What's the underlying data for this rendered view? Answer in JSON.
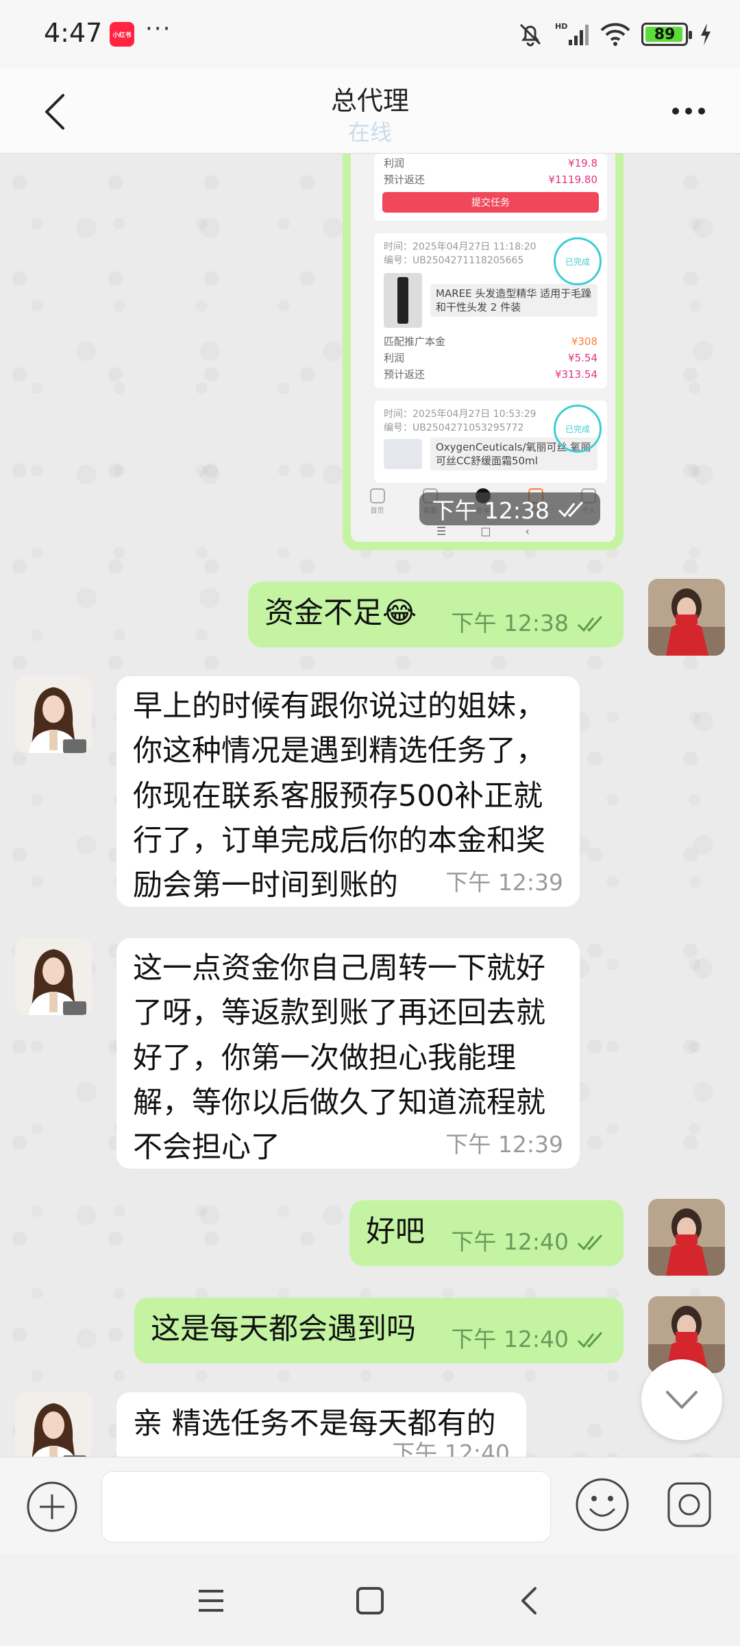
{
  "status_bar": {
    "time": "4:47",
    "app_badge": "小红书",
    "more": "···",
    "battery": "89"
  },
  "header": {
    "title": "总代理",
    "subtitle": "在线"
  },
  "shared_image": {
    "card1": {
      "profit_label": "利润",
      "profit_value": "¥19.8",
      "refund_label": "预计返还",
      "refund_value": "¥1119.80",
      "submit_label": "提交任务"
    },
    "card2": {
      "date": "时间：2025年04月27日 11:18:20",
      "order_no": "编号：UB2504271118205665",
      "product": "MAREE 头发造型精华 适用于毛躁和干性头发 2 件装",
      "principal_label": "匹配推广本金",
      "principal_value": "¥308",
      "profit_label": "利润",
      "profit_value": "¥5.54",
      "refund_label": "预计返还",
      "refund_value": "¥313.54",
      "stamp": "已完成"
    },
    "card3": {
      "date": "时间：2025年04月27日 10:53:29",
      "order_no": "编号：UB2504271053295772",
      "product": "OxygenCeuticals/氧丽可丝 氧丽可丝CC舒缓面霜50ml",
      "stamp": "已完成"
    },
    "tabs": [
      "首页",
      "客服",
      "抢单",
      "记录",
      "个人"
    ],
    "time": "下午 12:38"
  },
  "messages": [
    {
      "dir": "out",
      "text": "资金不足😂",
      "time": "下午 12:38"
    },
    {
      "dir": "in",
      "text": "早上的时候有跟你说过的姐妹，你这种情况是遇到精选任务了，你现在联系客服预存500补正就行了，订单完成后你的本金和奖励会第一时间到账的",
      "time": "下午 12:39"
    },
    {
      "dir": "in",
      "text": "这一点资金你自己周转一下就好了呀，等返款到账了再还回去就好了，你第一次做担心我能理解，等你以后做久了知道流程就不会担心了",
      "time": "下午 12:39"
    },
    {
      "dir": "out",
      "text": "好吧",
      "time": "下午 12:40"
    },
    {
      "dir": "out",
      "text": "这是每天都会遇到吗",
      "time": "下午 12:40"
    },
    {
      "dir": "in",
      "text": "亲 精选任务不是每天都有的",
      "time": "下午 12:40"
    }
  ],
  "input": {
    "placeholder": ""
  },
  "colors": {
    "outgoing_bubble": "#c4f4a2",
    "incoming_bubble": "#ffffff",
    "chat_bg": "#ebebeb",
    "status_link": "#c8dcec"
  }
}
